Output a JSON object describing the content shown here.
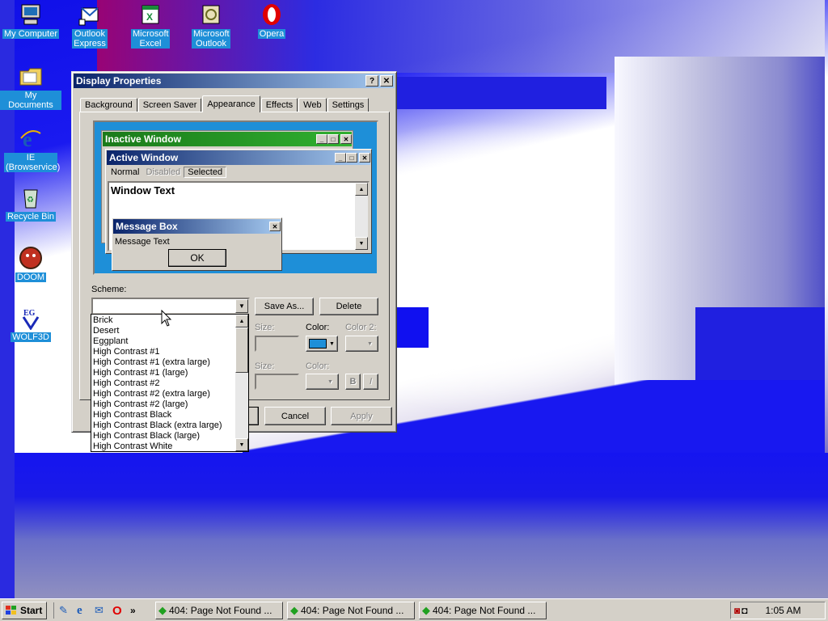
{
  "desktop": {
    "icons": [
      {
        "label": "My Computer"
      },
      {
        "label": "Outlook Express"
      },
      {
        "label": "Microsoft Excel"
      },
      {
        "label": "Microsoft Outlook"
      },
      {
        "label": "Opera"
      },
      {
        "label": "My Documents"
      },
      {
        "label": "IE (Browservice)"
      },
      {
        "label": "Recycle Bin"
      },
      {
        "label": "DOOM"
      },
      {
        "label": "WOLF3D"
      }
    ]
  },
  "dialog": {
    "title": "Display Properties",
    "help_btn": "?",
    "close_btn": "✕",
    "tabs": [
      "Background",
      "Screen Saver",
      "Appearance",
      "Effects",
      "Web",
      "Settings"
    ],
    "active_tab": "Appearance",
    "preview": {
      "inactive_title": "Inactive Window",
      "active_title": "Active Window",
      "menu": [
        "Normal",
        "Disabled",
        "Selected"
      ],
      "window_text": "Window Text",
      "msgbox_title": "Message Box",
      "msgbox_text": "Message Text",
      "ok": "OK"
    },
    "scheme_label": "Scheme:",
    "scheme_value": "",
    "save_as": "Save As...",
    "delete": "Delete",
    "size_label": "Size:",
    "color_label": "Color:",
    "color2_label": "Color 2:",
    "size_label2": "Size:",
    "color_label3": "Color:",
    "bold": "B",
    "italic": "I",
    "cancel": "Cancel",
    "apply": "Apply",
    "dropdown_items": [
      "Brick",
      "Desert",
      "Eggplant",
      "High Contrast #1",
      "High Contrast #1 (extra large)",
      "High Contrast #1 (large)",
      "High Contrast #2",
      "High Contrast #2 (extra large)",
      "High Contrast #2 (large)",
      "High Contrast Black",
      "High Contrast Black (extra large)",
      "High Contrast Black (large)",
      "High Contrast White"
    ]
  },
  "taskbar": {
    "start": "Start",
    "quicklaunch_more": "»",
    "tasks": [
      "404: Page Not Found ...",
      "404: Page Not Found ...",
      "404: Page Not Found ..."
    ],
    "clock": "1:05 AM"
  },
  "colors": {
    "title_active": "#0a246a",
    "title_gradient_end": "#a6caf0",
    "face": "#d4d0c8",
    "desktop_blue": "#1e1ee0",
    "icon_label_bg": "#1e8fd8",
    "preview_bg": "#1e8fd8",
    "inactive_title": "#1a7a1a"
  }
}
